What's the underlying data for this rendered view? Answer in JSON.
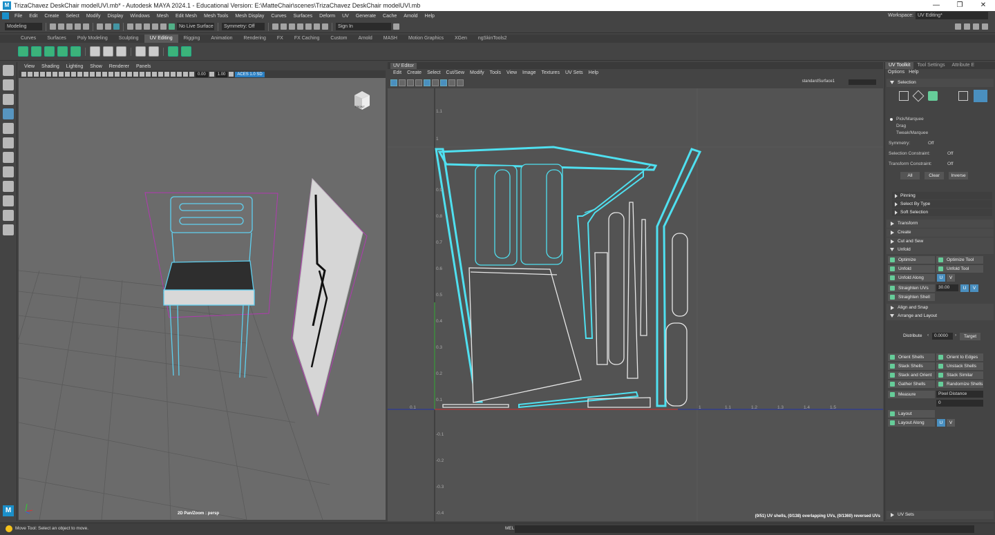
{
  "titlebar": {
    "title": "TrizaChavez DeskChair modelUVl.mb* - Autodesk MAYA 2024.1 - Educational Version: E:\\MatteChair\\scenes\\TrizaChavez DeskChair modelUVl.mb",
    "logo": "M",
    "minimize": "—",
    "restore": "❐",
    "close": "✕"
  },
  "menu": [
    "File",
    "Edit",
    "Create",
    "Select",
    "Modify",
    "Display",
    "Windows",
    "Mesh",
    "Edit Mesh",
    "Mesh Tools",
    "Mesh Display",
    "Curves",
    "Surfaces",
    "Deform",
    "UV",
    "Generate",
    "Cache",
    "Arnold",
    "Help"
  ],
  "workspace": {
    "label": "Workspace:",
    "value": "UV Editing*"
  },
  "statusline": {
    "mode": "Modeling",
    "live_surface": "No Live Surface",
    "symmetry": "Symmetry: Off",
    "sign_in": "Sign In"
  },
  "shelf_tabs": [
    "Curves",
    "Surfaces",
    "Poly Modeling",
    "Sculpting",
    "UV Editing",
    "Rigging",
    "Animation",
    "Rendering",
    "FX",
    "FX Caching",
    "Custom",
    "Arnold",
    "MASH",
    "Motion Graphics",
    "XGen",
    "ngSkinTools2"
  ],
  "shelf_active": "UV Editing",
  "viewport": {
    "menu": [
      "View",
      "Shading",
      "Lighting",
      "Show",
      "Renderer",
      "Panels"
    ],
    "field1": "0.00",
    "field2": "1.00",
    "colorspace": "ACES 1.0 SD",
    "label": "2D Pan/Zoom : persp",
    "cube_label": "FRONT"
  },
  "uv_editor": {
    "title": "UV Editor",
    "menu": [
      "Edit",
      "Create",
      "Select",
      "Cut/Sew",
      "Modify",
      "Tools",
      "View",
      "Image",
      "Textures",
      "UV Sets",
      "Help"
    ],
    "surface": "standardSurface1",
    "status": "(0/51) UV shells, (0/138) overlapping UVs, (0/1360) reversed UVs",
    "axis_left": [
      "1.1",
      "1",
      "0.9",
      "0.8",
      "0.7",
      "0.6",
      "0.5",
      "0.4",
      "0.3",
      "0.2",
      "0.1",
      "-0.1",
      "-0.2",
      "-0.3",
      "-0.4"
    ],
    "axis_bottom": [
      "0.1",
      "1",
      "1.1",
      "1.2",
      "1.3",
      "1.4",
      "1.5"
    ]
  },
  "right_panel": {
    "tabs": [
      "UV Toolkit",
      "Tool Settings",
      "Attribute E"
    ],
    "options": [
      "Options",
      "Help"
    ],
    "selection": "Selection",
    "modes": [
      "Pick/Marquee",
      "Drag",
      "Tweak/Marquee"
    ],
    "symmetry_label": "Symmetry:",
    "symmetry_value": "Off",
    "sel_constraint_label": "Selection Constraint:",
    "sel_constraint_value": "Off",
    "xform_constraint_label": "Transform Constraint:",
    "xform_constraint_value": "Off",
    "sel_buttons": [
      "All",
      "Clear",
      "Inverse"
    ],
    "subsections": [
      "Pinning",
      "Select By Type",
      "Soft Selection"
    ],
    "sections": [
      "Transform",
      "Create",
      "Cut and Sew"
    ],
    "unfold": "Unfold",
    "unfold_buttons": [
      "Optimize",
      "Optimize Tool",
      "Unfold",
      "Unfold Tool",
      "Unfold Along"
    ],
    "u": "U",
    "v": "V",
    "straighten_uvs": "Straighten UVs",
    "straighten_value": "30.00",
    "straighten_shell": "Straighten Shell",
    "align_snap": "Align and Snap",
    "arrange": "Arrange and Layout",
    "distribute_label": "Distribute",
    "distribute_value": "0.0000",
    "target": "Target",
    "arrange_buttons": [
      "Orient Shells",
      "Orient to Edges",
      "Stack Shells",
      "Unstack Shells",
      "Stack and Orient",
      "Stack Similar",
      "Gather Shells",
      "Randomize Shells"
    ],
    "measure": "Measure",
    "measure_mode": "Pixel Distance",
    "measure_value": "0",
    "layout": "Layout",
    "layout_along": "Layout Along",
    "uv_sets": "UV Sets"
  },
  "bottom": {
    "help": "Move Tool: Select an object to move.",
    "mel": "MEL"
  }
}
